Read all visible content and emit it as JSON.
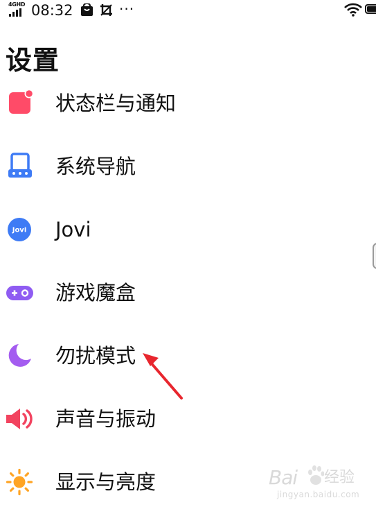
{
  "status_bar": {
    "network": "4GHD",
    "time": "08:32",
    "more": "···"
  },
  "page": {
    "title": "设置"
  },
  "settings": {
    "items": [
      {
        "label": "状态栏与通知",
        "icon": "notification-square-icon",
        "color": "#FF4B68"
      },
      {
        "label": "系统导航",
        "icon": "navigation-phone-icon",
        "color": "#3E7BF5"
      },
      {
        "label": "Jovi",
        "icon": "jovi-logo-icon",
        "icon_text": "Jovi",
        "color": "#3E7BF5"
      },
      {
        "label": "游戏魔盒",
        "icon": "gamepad-icon",
        "color": "#8F5CF2"
      },
      {
        "label": "勿扰模式",
        "icon": "moon-icon",
        "color": "#A45CF0"
      },
      {
        "label": "声音与振动",
        "icon": "speaker-icon",
        "color": "#F2435F"
      },
      {
        "label": "显示与亮度",
        "icon": "sun-icon",
        "color": "#FFA424"
      }
    ]
  },
  "annotation": {
    "color": "#E8262E"
  },
  "watermark": {
    "brand": "Bai",
    "product": "经验",
    "domain": "jingyan.baidu.com"
  }
}
